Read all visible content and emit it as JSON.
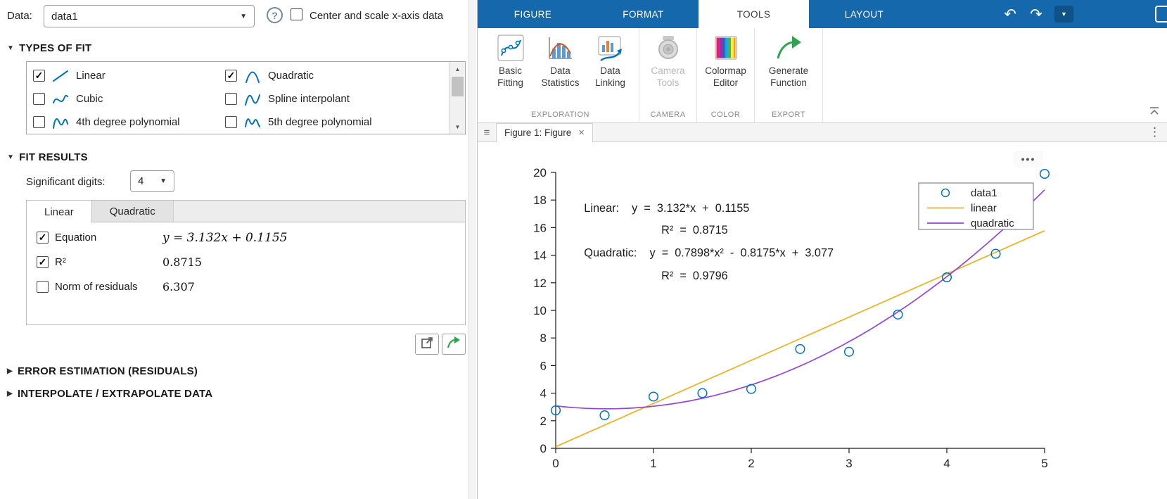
{
  "colors": {
    "accent_blue": "#0072BD",
    "linear_fit": "#EDB120",
    "quadratic_fit": "#9146D8",
    "ribbon_blue": "#1568AC",
    "generate_green": "#2EA44F"
  },
  "left_panel": {
    "data_label": "Data:",
    "data_value": "data1",
    "center_scale_checked": false,
    "center_scale_label": "Center and scale x-axis data",
    "types_of_fit": {
      "title": "TYPES OF FIT",
      "items": [
        {
          "label": "Linear",
          "checked": true,
          "icon": "linear-fit-icon"
        },
        {
          "label": "Quadratic",
          "checked": true,
          "icon": "quadratic-fit-icon"
        },
        {
          "label": "Cubic",
          "checked": false,
          "icon": "cubic-fit-icon"
        },
        {
          "label": "Spline interpolant",
          "checked": false,
          "icon": "spline-fit-icon"
        },
        {
          "label": "4th degree polynomial",
          "checked": false,
          "icon": "poly4-fit-icon"
        },
        {
          "label": "5th degree polynomial",
          "checked": false,
          "icon": "poly5-fit-icon"
        }
      ]
    },
    "fit_results": {
      "title": "FIT RESULTS",
      "sig_digits_label": "Significant digits:",
      "sig_digits_value": "4",
      "tabs": [
        "Linear",
        "Quadratic"
      ],
      "active_tab": "Linear",
      "rows": [
        {
          "label": "Equation",
          "checked": true,
          "value": "y = 3.132x + 0.1155",
          "math": true
        },
        {
          "label": "R²",
          "checked": true,
          "value": "0.8715",
          "math": false
        },
        {
          "label": "Norm of residuals",
          "checked": false,
          "value": "6.307",
          "math": false
        }
      ]
    },
    "collapsed_sections": [
      "ERROR ESTIMATION (RESIDUALS)",
      "INTERPOLATE / EXTRAPOLATE DATA"
    ]
  },
  "ribbon": {
    "tabs": [
      "FIGURE",
      "FORMAT",
      "TOOLS",
      "LAYOUT"
    ],
    "active_tab": "TOOLS",
    "groups": [
      {
        "label": "EXPLORATION",
        "buttons": [
          {
            "lines": [
              "Basic",
              "Fitting"
            ],
            "icon": "basic-fitting-icon",
            "enabled": true
          },
          {
            "lines": [
              "Data",
              "Statistics"
            ],
            "icon": "data-statistics-icon",
            "enabled": true
          },
          {
            "lines": [
              "Data",
              "Linking"
            ],
            "icon": "data-linking-icon",
            "enabled": true
          }
        ]
      },
      {
        "label": "CAMERA",
        "buttons": [
          {
            "lines": [
              "Camera",
              "Tools"
            ],
            "icon": "camera-tools-icon",
            "enabled": false
          }
        ]
      },
      {
        "label": "COLOR",
        "buttons": [
          {
            "lines": [
              "Colormap",
              "Editor"
            ],
            "icon": "colormap-editor-icon",
            "enabled": true
          }
        ]
      },
      {
        "label": "EXPORT",
        "buttons": [
          {
            "lines": [
              "Generate",
              "Function"
            ],
            "icon": "generate-function-icon",
            "enabled": true,
            "wide": true
          }
        ]
      }
    ]
  },
  "figure_tab": {
    "title": "Figure 1: Figure"
  },
  "chart_data": {
    "type": "scatter",
    "title": "",
    "xlabel": "",
    "ylabel": "",
    "xlim": [
      0,
      5
    ],
    "ylim": [
      0,
      20
    ],
    "xticks": [
      0,
      1,
      2,
      3,
      4,
      5
    ],
    "yticks": [
      0,
      2,
      4,
      6,
      8,
      10,
      12,
      14,
      16,
      18,
      20
    ],
    "grid": false,
    "series": [
      {
        "name": "data1",
        "type": "scatter",
        "color": "#0072BD",
        "x": [
          0,
          0.5,
          1,
          1.5,
          2,
          2.5,
          3,
          3.5,
          4,
          4.5,
          5
        ],
        "y": [
          2.75,
          2.4,
          3.75,
          4.0,
          4.3,
          7.2,
          7.0,
          9.7,
          12.4,
          14.1,
          19.9
        ]
      },
      {
        "name": "linear",
        "type": "fit",
        "color": "#EDB120",
        "coeffs": [
          3.132,
          0.1155
        ],
        "equation": "y = 3.132*x + 0.1155",
        "r2": 0.8715
      },
      {
        "name": "quadratic",
        "type": "fit",
        "color": "#9146D8",
        "coeffs": [
          0.7898,
          -0.8175,
          3.077
        ],
        "equation": "y = 0.7898*x² - 0.8175*x + 3.077",
        "r2": 0.9796
      }
    ],
    "annotations": [
      {
        "x": 0.29,
        "y": 17.15,
        "text": "Linear:    y  =  3.132*x  +  0.1155"
      },
      {
        "x": 1.08,
        "y": 15.55,
        "text": "R²  =  0.8715"
      },
      {
        "x": 0.29,
        "y": 13.9,
        "text": "Quadratic:    y  =  0.7898*x²  -  0.8175*x  +  3.077"
      },
      {
        "x": 1.08,
        "y": 12.25,
        "text": "R²  =  0.9796"
      }
    ],
    "legend": {
      "position": "northeast",
      "entries": [
        "data1",
        "linear",
        "quadratic"
      ]
    }
  }
}
